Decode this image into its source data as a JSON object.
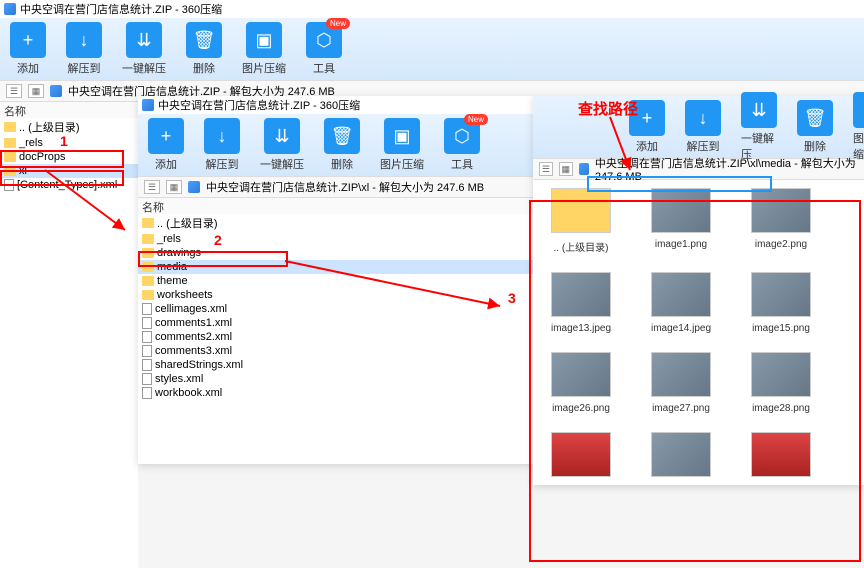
{
  "app": {
    "title_suffix": " - 360压缩",
    "file": "中央空调在营门店信息统计.ZIP",
    "size": "247.6 MB"
  },
  "toolbar": {
    "add": "添加",
    "extract": "解压到",
    "oneclick": "一键解压",
    "delete": "删除",
    "imgcompress": "图片压缩",
    "tools": "工具",
    "new": "New"
  },
  "side": {
    "name": "名称"
  },
  "tree1": {
    "up": ".. (上级目录)",
    "rels": "_rels",
    "docprops": "docProps",
    "xl": "xl",
    "contenttype": "[Content_Types].xml"
  },
  "path2": "中央空调在营门店信息统计.ZIP\\xl - 解包大小为 247.6 MB",
  "tree2": {
    "up": ".. (上级目录)",
    "rels": "_rels",
    "drawings": "drawings",
    "media": "media",
    "theme": "theme",
    "worksheets": "worksheets",
    "cellimages": "cellimages.xml",
    "c1": "comments1.xml",
    "c2": "comments2.xml",
    "c3": "comments3.xml",
    "ss": "sharedStrings.xml",
    "styles": "styles.xml",
    "wb": "workbook.xml"
  },
  "path3": "中央空调在营门店信息统计.ZIP\\xl\\media",
  "path3suffix": " - 解包大小为 247.6 MB",
  "grid": {
    "up": ".. (上级目录)",
    "i1": "image1.png",
    "i2": "image2.png",
    "i13": "image13.jpeg",
    "i14": "image14.jpeg",
    "i15": "image15.png",
    "i26": "image26.png",
    "i27": "image27.png",
    "i28": "image28.png"
  },
  "anno": {
    "n1": "1",
    "n2": "2",
    "n3": "3",
    "find": "查找路径"
  },
  "title1": "中央空调在营门店信息统计.ZIP - 360压缩",
  "title2": "中央空调在营门店信息统计.ZIP - 360压缩",
  "bc1": "中央空调在营门店信息统计.ZIP - 解包大小为 247.6 MB"
}
